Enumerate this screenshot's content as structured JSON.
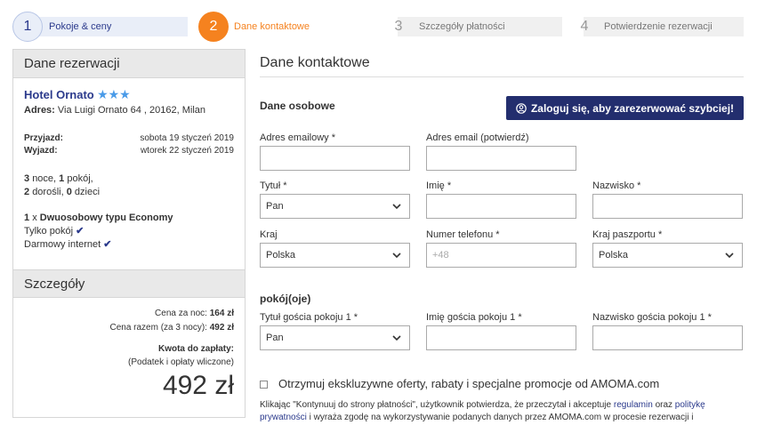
{
  "stepper": {
    "steps": [
      {
        "number": "1",
        "label": "Pokoje & ceny",
        "state": "done"
      },
      {
        "number": "2",
        "label": "Dane kontaktowe",
        "state": "current"
      },
      {
        "number": "3",
        "label": "Szczegóły płatności",
        "state": "future"
      },
      {
        "number": "4",
        "label": "Potwierdzenie rezerwacji",
        "state": "future"
      }
    ]
  },
  "sidebar": {
    "title": "Dane rezerwacji",
    "hotel_name": "Hotel Ornato",
    "stars": "★★★",
    "address_label": "Adres:",
    "address_value": "Via Luigi Ornato 64 , 20162, Milan",
    "checkin_label": "Przyjazd:",
    "checkin_value": "sobota 19 styczeń 2019",
    "checkout_label": "Wyjazd:",
    "checkout_value": "wtorek 22 styczeń 2019",
    "nights_count": "3",
    "nights_label": "noce,",
    "rooms_count": "1",
    "rooms_label": "pokój,",
    "adults_count": "2",
    "adults_label": "dorośli,",
    "children_count": "0",
    "children_label": "dzieci",
    "room_qty": "1",
    "room_x": "x",
    "room_type": "Dwuosobowy typu Economy",
    "feature_1": "Tylko pokój",
    "feature_2": "Darmowy internet",
    "check_icon": "✔",
    "details_title": "Szczegóły",
    "price_per_night_label": "Cena za noc:",
    "price_per_night_value": "164 zł",
    "price_total_label": "Cena razem (za 3 nocy):",
    "price_total_value": "492 zł",
    "to_pay_label": "Kwota do zapłaty:",
    "taxes_note": "(Podatek i opłaty wliczone)",
    "big_price": "492 zł"
  },
  "main": {
    "title": "Dane kontaktowe",
    "personal_title": "Dane osobowe",
    "login_button": "Zaloguj się, aby zarezerwować szybciej!",
    "email_label": "Adres emailowy *",
    "email_value": "",
    "email_confirm_label": "Adres email (potwierdź)",
    "email_confirm_value": "",
    "title_label": "Tytuł *",
    "title_value": "Pan",
    "first_name_label": "Imię *",
    "first_name_value": "",
    "last_name_label": "Nazwisko *",
    "last_name_value": "",
    "country_label": "Kraj",
    "country_value": "Polska",
    "phone_label": "Numer telefonu *",
    "phone_placeholder": "+48",
    "passport_country_label": "Kraj paszportu *",
    "passport_country_value": "Polska",
    "rooms_title": "pokój(oje)",
    "guest_title_label": "Tytuł gościa pokoju 1 *",
    "guest_title_value": "Pan",
    "guest_first_label": "Imię gościa pokoju 1 *",
    "guest_first_value": "",
    "guest_last_label": "Nazwisko gościa pokoju 1 *",
    "guest_last_value": "",
    "offers_text": "Otrzymuj ekskluzywne oferty, rabaty i specjalne promocje od AMOMA.com",
    "consent_1": "Klikając \"Kontynuuj do strony płatności\", użytkownik potwierdza, że przeczytał i akceptuje",
    "consent_link_1": "regulamin",
    "consent_2": "oraz",
    "consent_link_2": "politykę prywatności",
    "consent_3": "i wyraża zgodę na wykorzystywanie podanych danych przez AMOMA.com w procesie rezerwacji i"
  },
  "colors": {
    "brand_navy": "#232e6e",
    "active_orange": "#f5821f",
    "link_blue": "#2b3a8c",
    "star_blue": "#4a9be8"
  }
}
